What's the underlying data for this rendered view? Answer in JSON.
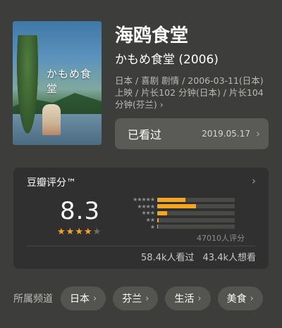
{
  "movie": {
    "title": "海鸥食堂",
    "original_title": "かもめ食堂 (2006)",
    "meta": "日本 / 喜剧 剧情 / 2006-03-11(日本)上映 / 片长102 分钟(日本) / 片长104 分钟(芬兰) ›",
    "poster_text": "かもめ食堂"
  },
  "watch_status": {
    "label": "已看过",
    "date": "2019.05.17"
  },
  "rating": {
    "label": "豆瓣评分™",
    "score": "8.3",
    "stars_filled": 4,
    "stars_total": 5,
    "distribution": [
      {
        "stars": "★★★★★",
        "fraction": 0.36
      },
      {
        "stars": "★★★★",
        "fraction": 0.5
      },
      {
        "stars": "★★★",
        "fraction": 0.13
      },
      {
        "stars": "★★",
        "fraction": 0.02
      },
      {
        "stars": "★",
        "fraction": 0.01
      }
    ],
    "count_text": "47010人评分",
    "watched": "58.4k人看过",
    "want": "43.4k人想看"
  },
  "channels": {
    "label": "所属频道",
    "items": [
      "日本",
      "芬兰",
      "生活",
      "美食"
    ]
  },
  "colors": {
    "background": "#3d3d3b",
    "card": "#303030",
    "accent_star": "#f5a623"
  }
}
